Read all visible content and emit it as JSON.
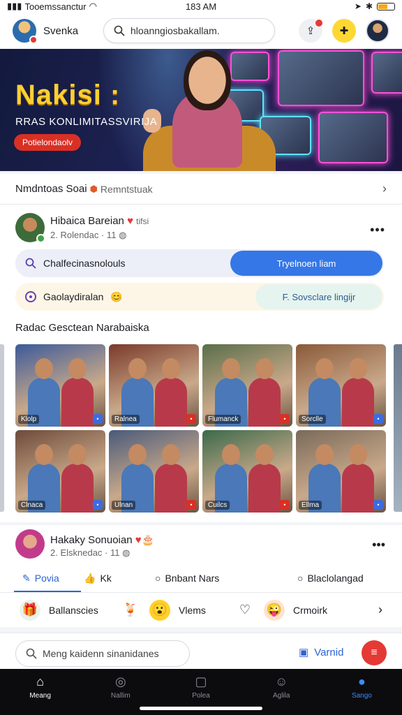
{
  "status": {
    "carrier": "Tooemssanctur",
    "time": "183 AM"
  },
  "header": {
    "app_name": "Svenka",
    "search_placeholder": "hloanngiosbakallam."
  },
  "hero": {
    "title": "Nakisi :",
    "subtitle": "RRAS KONLIMITASSVIRIJA",
    "button": "Potielondaolv"
  },
  "section": {
    "title": "Nmdntoas Soai",
    "subtitle": "Remntstuak"
  },
  "post": {
    "author": "Hibaica Bareian",
    "meta": "2. Rolendac · 11",
    "suffix": "tifsi",
    "bar1_label": "Chalfecinasnolouls",
    "bar1_button": "Tryelnoen liam",
    "bar2_label": "Gaolaydiralan",
    "bar2_button": "F. Sovsclare lingijr",
    "gallery_title": "Radac Gesctean Narabaiska",
    "gallery": [
      {
        "caption": "Klolp",
        "color": "#3c5a9a"
      },
      {
        "caption": "Ralnea",
        "color": "#7a3a2a"
      },
      {
        "caption": "Flumanck",
        "color": "#5a6e4a"
      },
      {
        "caption": "Sorclle",
        "color": "#8a5a3a"
      },
      {
        "caption": "Clnaca",
        "color": "#6d4a3a"
      },
      {
        "caption": "Ulnan",
        "color": "#4a5a7a"
      },
      {
        "caption": "Cuilcs",
        "color": "#3a6a4a"
      },
      {
        "caption": "Ellma",
        "color": "#7a6a5a"
      }
    ]
  },
  "post2": {
    "author": "Hakaky Sonuoian",
    "meta": "2. Elsknedac · 11",
    "actions": [
      "Povia",
      "Kk",
      "Bnbant Nars",
      "Blaclolangad"
    ]
  },
  "reactions": [
    "Ballanscies",
    "Vlems",
    "Crmoirk"
  ],
  "composer": {
    "placeholder": "Meng kaidenn sinanidanes",
    "button": "Varnid"
  },
  "nav": [
    "Meang",
    "Nallim",
    "Polea",
    "Aglila",
    "Sango"
  ]
}
